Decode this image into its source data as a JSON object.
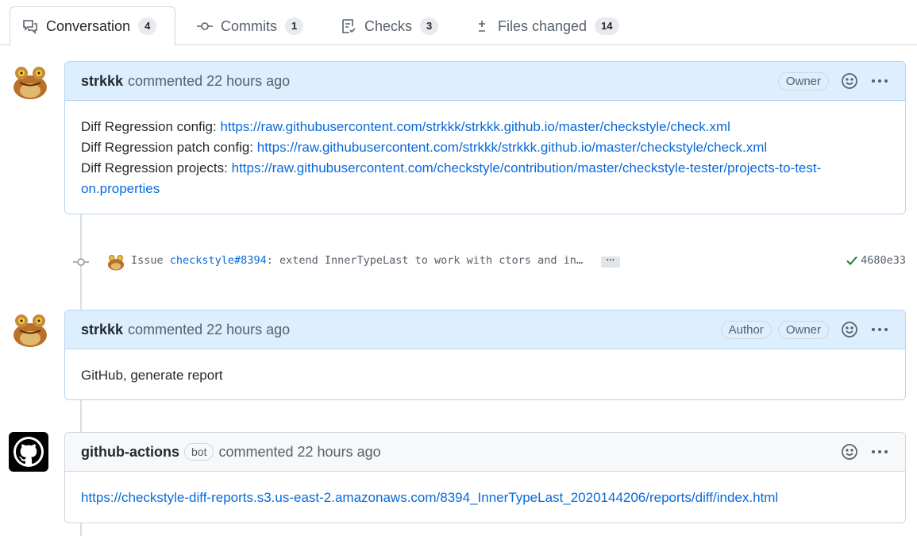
{
  "tabs": [
    {
      "label": "Conversation",
      "count": "4",
      "icon": "comment-discussion-icon"
    },
    {
      "label": "Commits",
      "count": "1",
      "icon": "git-commit-icon"
    },
    {
      "label": "Checks",
      "count": "3",
      "icon": "checklist-icon"
    },
    {
      "label": "Files changed",
      "count": "14",
      "icon": "diff-icon"
    }
  ],
  "comments": [
    {
      "author": "strkkk",
      "meta": "commented 22 hours ago",
      "labels": [
        "Owner"
      ],
      "lines": [
        {
          "prefix": "Diff Regression config: ",
          "link": "https://raw.githubusercontent.com/strkkk/strkkk.github.io/master/checkstyle/check.xml"
        },
        {
          "prefix": "Diff Regression patch config: ",
          "link": "https://raw.githubusercontent.com/strkkk/strkkk.github.io/master/checkstyle/check.xml"
        },
        {
          "prefix": "Diff Regression projects: ",
          "link": "https://raw.githubusercontent.com/checkstyle/contribution/master/checkstyle-tester/projects-to-test-on.properties"
        }
      ]
    },
    {
      "author": "strkkk",
      "meta": "commented 22 hours ago",
      "labels": [
        "Author",
        "Owner"
      ],
      "text": "GitHub, generate report"
    },
    {
      "author": "github-actions",
      "bot": "bot",
      "meta": "commented 22 hours ago",
      "link": "https://checkstyle-diff-reports.s3.us-east-2.amazonaws.com/8394_InnerTypeLast_2020144206/reports/diff/index.html"
    }
  ],
  "commit": {
    "prefix": "Issue ",
    "issue_link": "checkstyle#8394",
    "suffix": ": extend InnerTypeLast to work with ctors and in…",
    "ellipsis": "···",
    "sha": "4680e33",
    "status_color": "#1a7f37"
  },
  "colors": {
    "link": "#0969da",
    "owner_header_bg": "#ddeeff",
    "bot_header_bg": "#f6f8fa"
  }
}
